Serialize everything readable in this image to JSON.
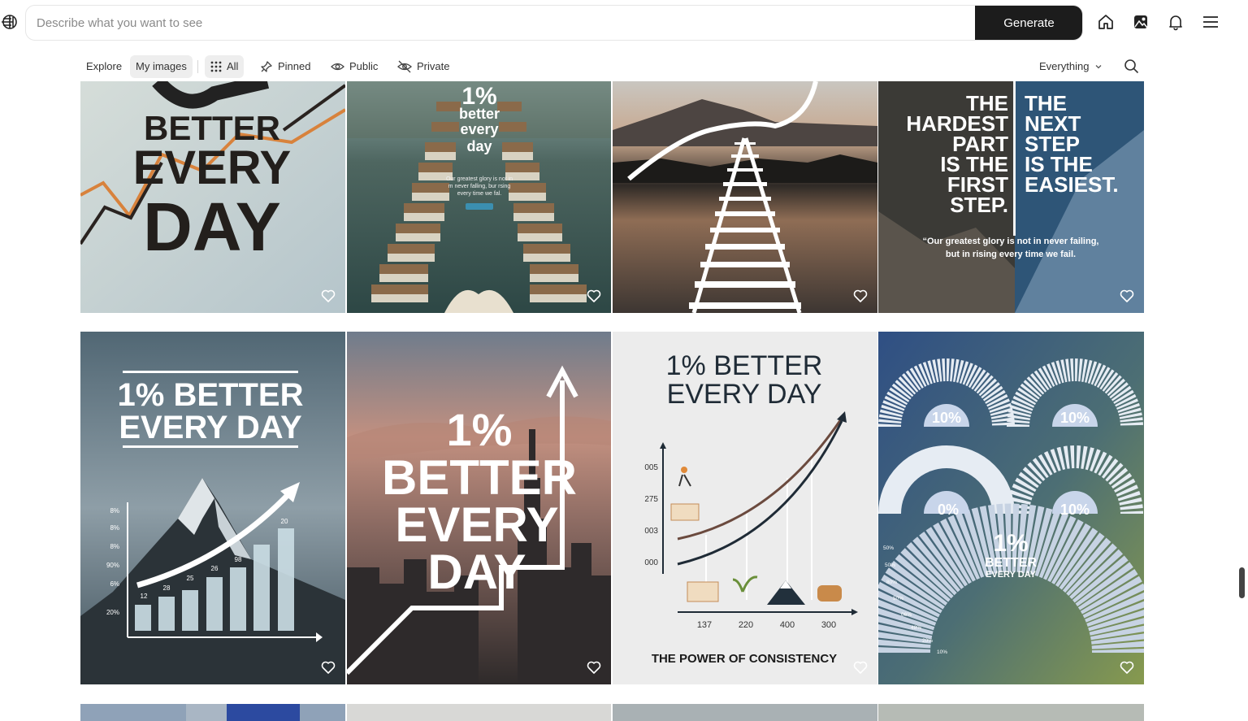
{
  "header": {
    "search_placeholder": "Describe what you want to see",
    "generate_label": "Generate",
    "icons": [
      "brand-logo-icon",
      "home-icon",
      "gallery-icon",
      "bell-icon",
      "menu-icon"
    ]
  },
  "filters": {
    "explore": "Explore",
    "my_images": "My images",
    "all": "All",
    "pinned": "Pinned",
    "public": "Public",
    "private": "Private",
    "sort_value": "Everything"
  },
  "cards": {
    "c1": {
      "l1": "BETTER",
      "l2": "EVERY",
      "l3": "DAY"
    },
    "c2": {
      "l1": "1%",
      "l2": "better",
      "l3": "every",
      "l4": "day",
      "quote1": "Our greatest glory is not in",
      "quote2": "m never falling, bur rsing",
      "quote3": "every time we fal."
    },
    "c4": {
      "left": [
        "THE",
        "HARDEST",
        "PART",
        "IS THE",
        "FIRST",
        "STEP."
      ],
      "right": [
        "THE",
        "NEXT",
        "STEP",
        "IS THE",
        "EASIEST."
      ],
      "quote1": "“Our greatest glory is not in never failing,",
      "quote2": "but in rising every time we fail."
    },
    "c5": {
      "l1": "1% BETTER",
      "l2": "EVERY DAY",
      "yticks": [
        "8%",
        "8%",
        "8%",
        "90%",
        "6%",
        "20%"
      ],
      "labels": [
        "12",
        "28",
        "25",
        "26",
        "98",
        "20"
      ]
    },
    "c6": {
      "l1": "1%",
      "l2": "BETTER",
      "l3": "EVERY",
      "l4": "DAY"
    },
    "c7": {
      "l1": "1% BETTER",
      "l2": "EVERY DAY",
      "yticks": [
        "005",
        "275",
        "003",
        "000"
      ],
      "xticks": [
        "137",
        "220",
        "400",
        "300"
      ],
      "footer": "THE POWER OF CONSISTENCY"
    },
    "c8": {
      "g1": "10%",
      "g2": "10%",
      "g3": "0%",
      "g4": "10%",
      "l1": "1%",
      "l2": "BETTER",
      "l3": "EVERY DAY",
      "side": [
        "50%",
        "50%",
        "80%",
        "50%",
        "06%",
        "48%",
        "20%",
        "10%"
      ]
    }
  },
  "heart_icon": "heart-icon"
}
